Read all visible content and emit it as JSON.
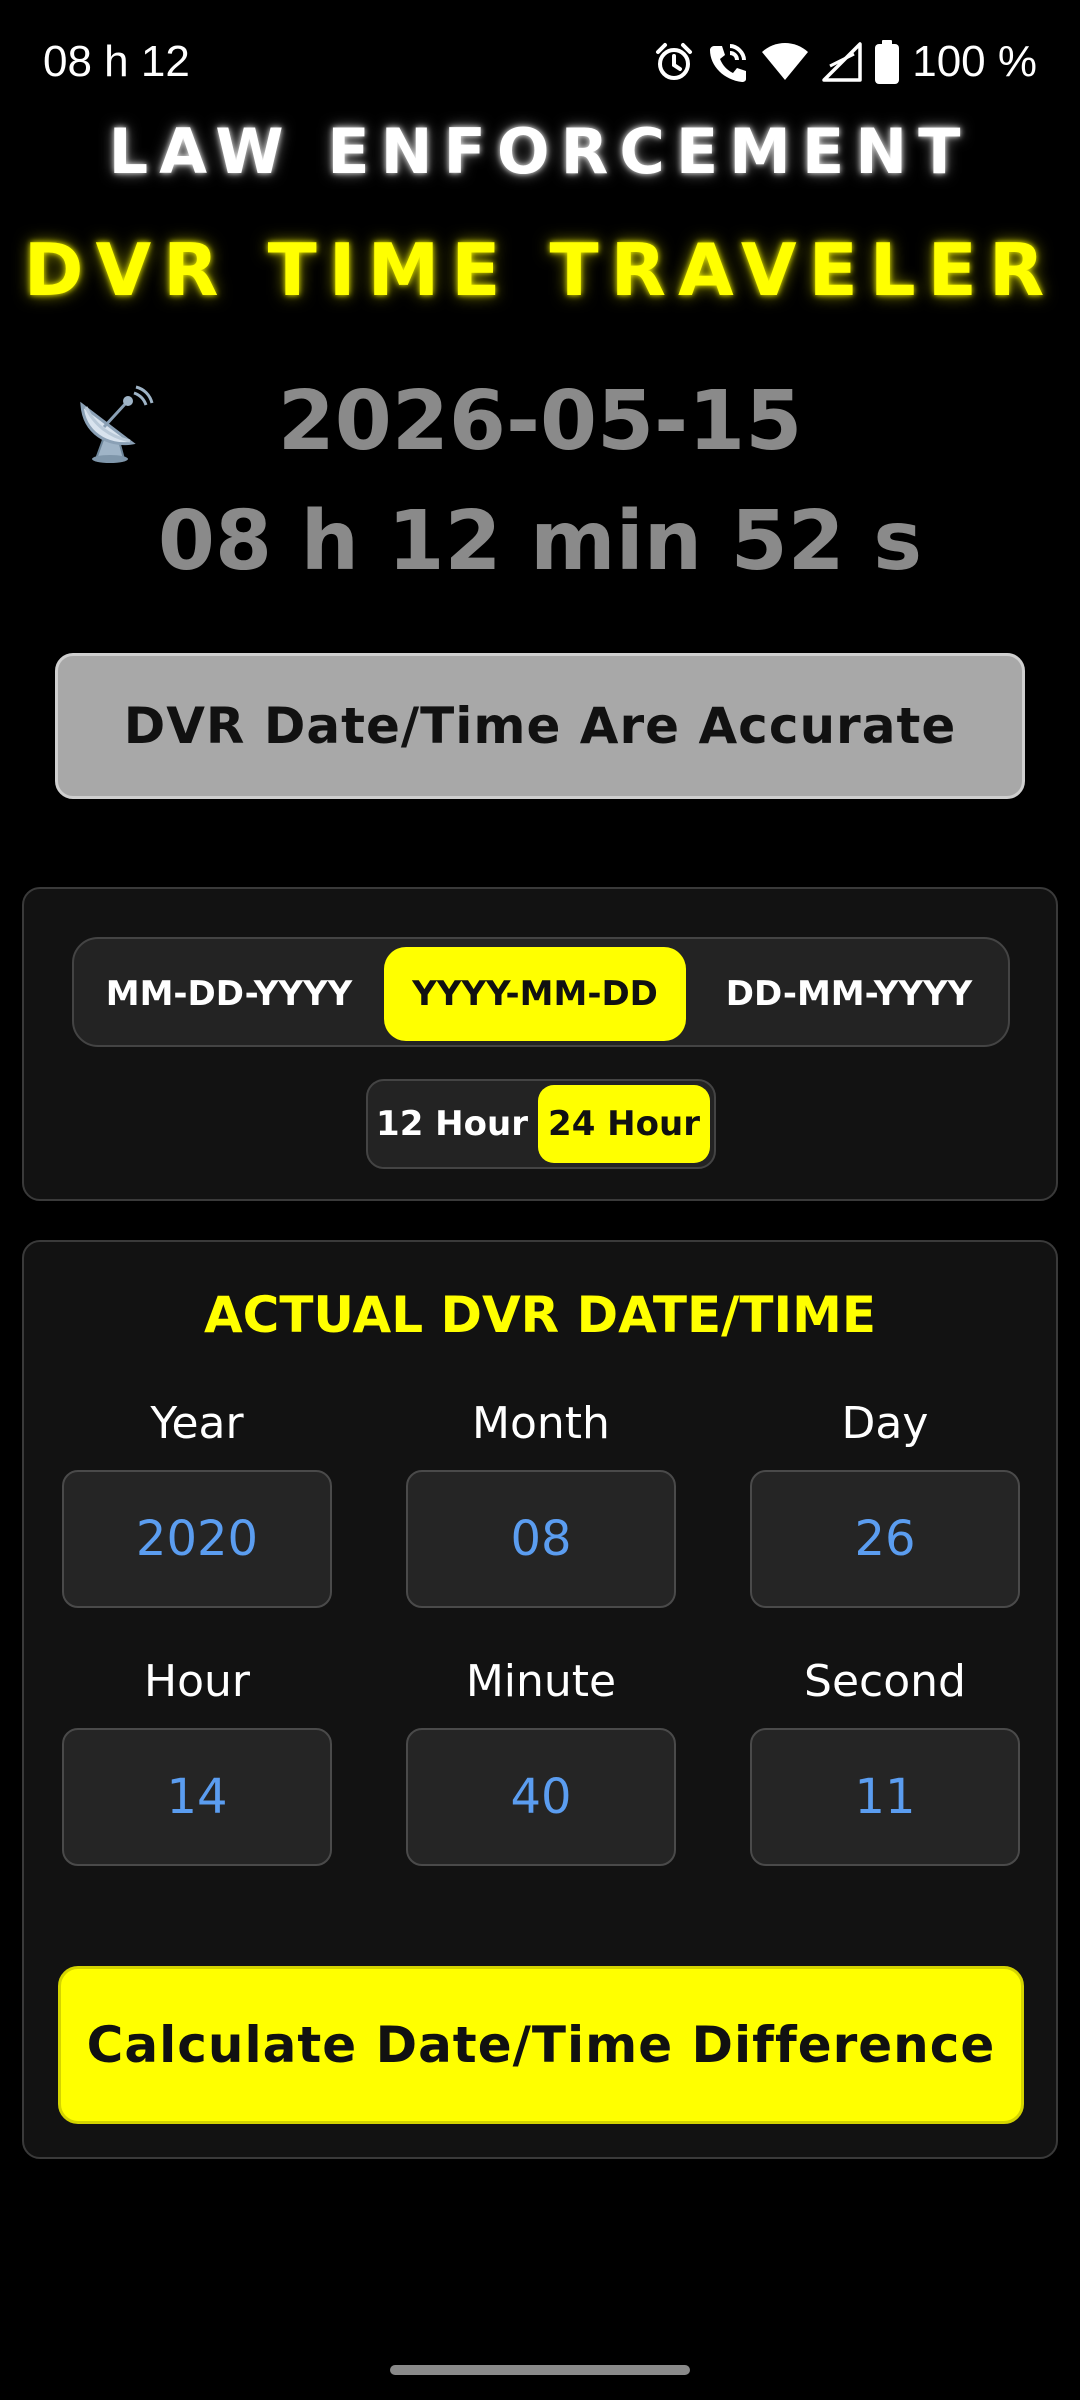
{
  "status_bar": {
    "time": "08 h 12",
    "battery_text": "100 %",
    "icons": [
      "alarm-icon",
      "wifi-calling-icon",
      "wifi-icon",
      "signal-icon",
      "battery-icon"
    ]
  },
  "header": {
    "line1": "LAW ENFORCEMENT",
    "line2": "DVR TIME TRAVELER"
  },
  "current": {
    "icon": "satellite-dish-icon",
    "date": "2026-05-15",
    "time": "08 h 12 min 52 s"
  },
  "accurate_button_label": "DVR Date/Time Are Accurate",
  "date_format": {
    "options": [
      "MM-DD-YYYY",
      "YYYY-MM-DD",
      "DD-MM-YYYY"
    ],
    "selected": "YYYY-MM-DD"
  },
  "hour_format": {
    "options": [
      "12 Hour",
      "24 Hour"
    ],
    "selected": "24 Hour"
  },
  "actual": {
    "title": "ACTUAL DVR DATE/TIME",
    "fields": [
      {
        "label": "Year",
        "value": "2020"
      },
      {
        "label": "Month",
        "value": "08"
      },
      {
        "label": "Day",
        "value": "26"
      },
      {
        "label": "Hour",
        "value": "14"
      },
      {
        "label": "Minute",
        "value": "40"
      },
      {
        "label": "Second",
        "value": "11"
      }
    ]
  },
  "calculate_button_label": "Calculate Date/Time Difference",
  "colors": {
    "background": "#000000",
    "accent_yellow": "#ffff00",
    "muted_gray": "#8a8a8a",
    "field_value_blue": "#5b9df0",
    "panel": "#121212"
  }
}
